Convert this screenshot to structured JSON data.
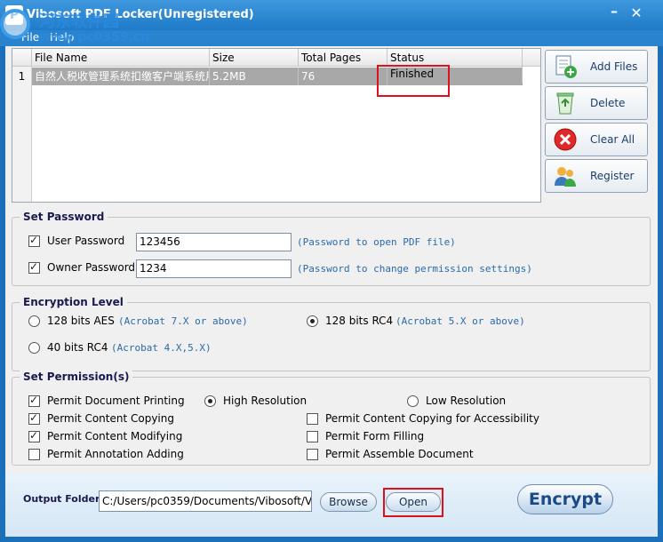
{
  "window": {
    "title": "Vibosoft PDF Locker(Unregistered)",
    "minimize": "–",
    "close": "✕"
  },
  "menu": [
    "File",
    "Help"
  ],
  "watermark": {
    "text": "河东软件园",
    "url": "www.pc0359.cn"
  },
  "table": {
    "columns": [
      "File Name",
      "Size",
      "Total Pages",
      "Status"
    ],
    "rows": [
      {
        "num": "1",
        "file_name": "自然人税收管理系统扣缴客户端系统用户",
        "size": "5.2MB",
        "pages": "76",
        "status": "Finished"
      }
    ]
  },
  "side_buttons": [
    "Add Files",
    "Delete",
    "Clear All",
    "Register"
  ],
  "password": {
    "title": "Set Password",
    "user": {
      "label": "User Password",
      "checked": true,
      "value": "123456",
      "hint": "(Password to open PDF file)"
    },
    "owner": {
      "label": "Owner Password",
      "checked": true,
      "value": "1234",
      "hint": "(Password to change permission settings)"
    }
  },
  "encryption": {
    "title": "Encryption Level",
    "options": [
      {
        "label": "128 bits AES",
        "hint": "(Acrobat 7.X or above)",
        "selected": false
      },
      {
        "label": "128 bits RC4",
        "hint": "(Acrobat 5.X or above)",
        "selected": true
      },
      {
        "label": "40 bits RC4",
        "hint": "(Acrobat 4.X,5.X)",
        "selected": false
      }
    ]
  },
  "permissions": {
    "title": "Set Permission(s)",
    "printing": "Permit Document Printing",
    "high_res": "High Resolution",
    "low_res": "Low Resolution",
    "copying": "Permit Content Copying",
    "copying_access": "Permit Content Copying for Accessibility",
    "modifying": "Permit Content Modifying",
    "form_filling": "Permit Form Filling",
    "annotation": "Permit Annotation Adding",
    "assemble": "Permit Assemble Document"
  },
  "output": {
    "label": "Output Folder:",
    "path": "C:/Users/pc0359/Documents/Vibosoft/V",
    "browse": "Browse",
    "open": "Open",
    "encrypt": "Encrypt"
  },
  "colors": {
    "title_bar": "#1f7bc9",
    "highlight_box": "#e0101a",
    "hint_text": "#2a6aa8"
  }
}
